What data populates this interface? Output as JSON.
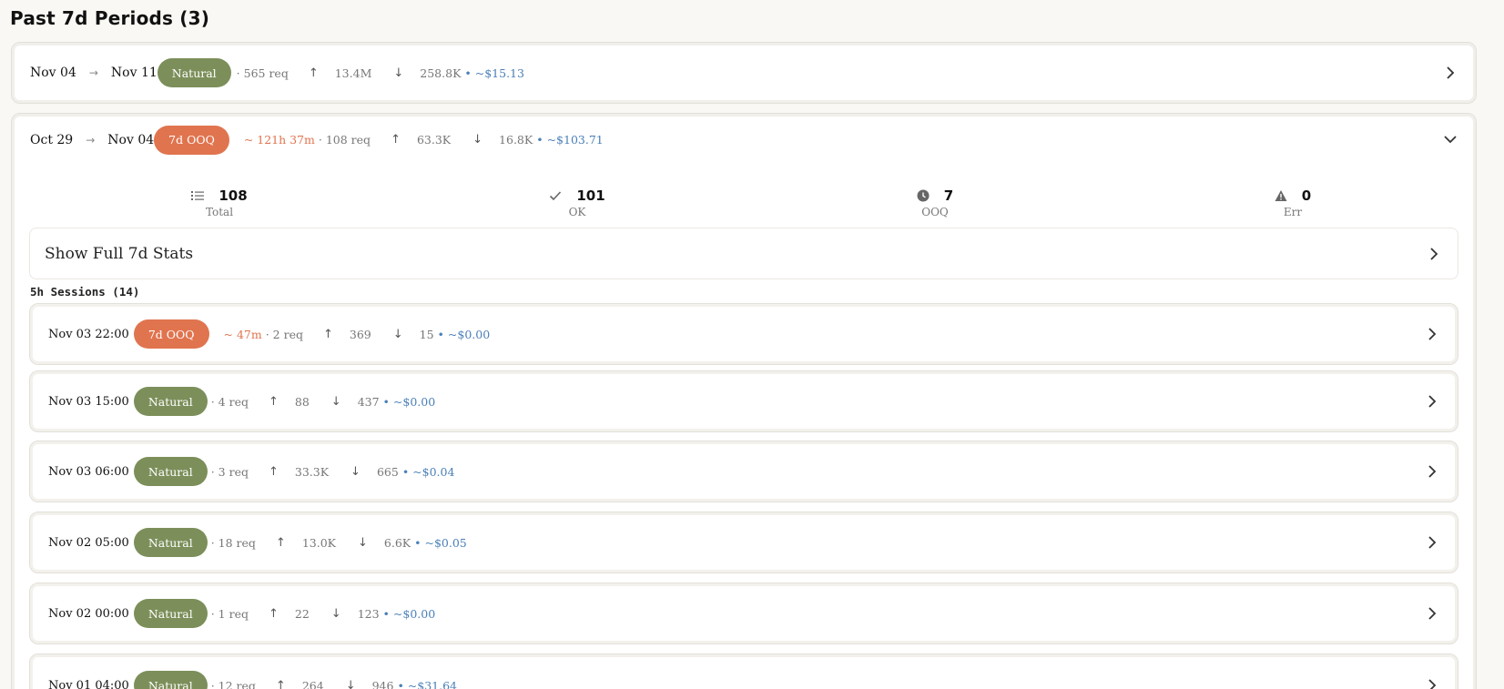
{
  "page_title": "Past 7d Periods (3)",
  "periods": [
    {
      "start": "Nov 04",
      "arrow": "→",
      "end": "Nov 11",
      "badge": "Natural",
      "req": "· 565 req",
      "up": "13.4M",
      "down": "258.8K",
      "cost": "• ~$15.13"
    },
    {
      "start": "Oct 29",
      "arrow": "→",
      "end": "Nov 04",
      "badge": "7d OOQ",
      "ooq_time": "~ 121h 37m",
      "req": "· 108 req",
      "up": "63.3K",
      "down": "16.8K",
      "cost": "• ~$103.71"
    }
  ],
  "stats": [
    {
      "value": "108",
      "label": "Total",
      "icon": "list-icon"
    },
    {
      "value": "101",
      "label": "OK",
      "icon": "check-icon"
    },
    {
      "value": "7",
      "label": "OOQ",
      "icon": "clock-icon"
    },
    {
      "value": "0",
      "label": "Err",
      "icon": "warning-icon"
    }
  ],
  "full_stats_label": "Show Full 7d Stats",
  "sessions_heading": "5h Sessions (14)",
  "sessions": [
    {
      "date": "Nov 03 22:00",
      "badge": "7d OOQ",
      "ooq_time": "~ 47m",
      "req": "· 2 req",
      "up": "369",
      "down": "15",
      "cost": "• ~$0.00"
    },
    {
      "date": "Nov 03 15:00",
      "badge": "Natural",
      "req": "· 4 req",
      "up": "88",
      "down": "437",
      "cost": "• ~$0.00"
    },
    {
      "date": "Nov 03 06:00",
      "badge": "Natural",
      "req": "· 3 req",
      "up": "33.3K",
      "down": "665",
      "cost": "• ~$0.04"
    },
    {
      "date": "Nov 02 05:00",
      "badge": "Natural",
      "req": "· 18 req",
      "up": "13.0K",
      "down": "6.6K",
      "cost": "• ~$0.05"
    },
    {
      "date": "Nov 02 00:00",
      "badge": "Natural",
      "req": "· 1 req",
      "up": "22",
      "down": "123",
      "cost": "• ~$0.00"
    },
    {
      "date": "Nov 01 04:00",
      "badge": "Natural",
      "req": "· 12 req",
      "up": "264",
      "down": "946",
      "cost": "• ~$31.64"
    }
  ],
  "colors": {
    "natural": "#7c8f5a",
    "ooq": "#e0744f",
    "cost": "#4a7fb8"
  }
}
